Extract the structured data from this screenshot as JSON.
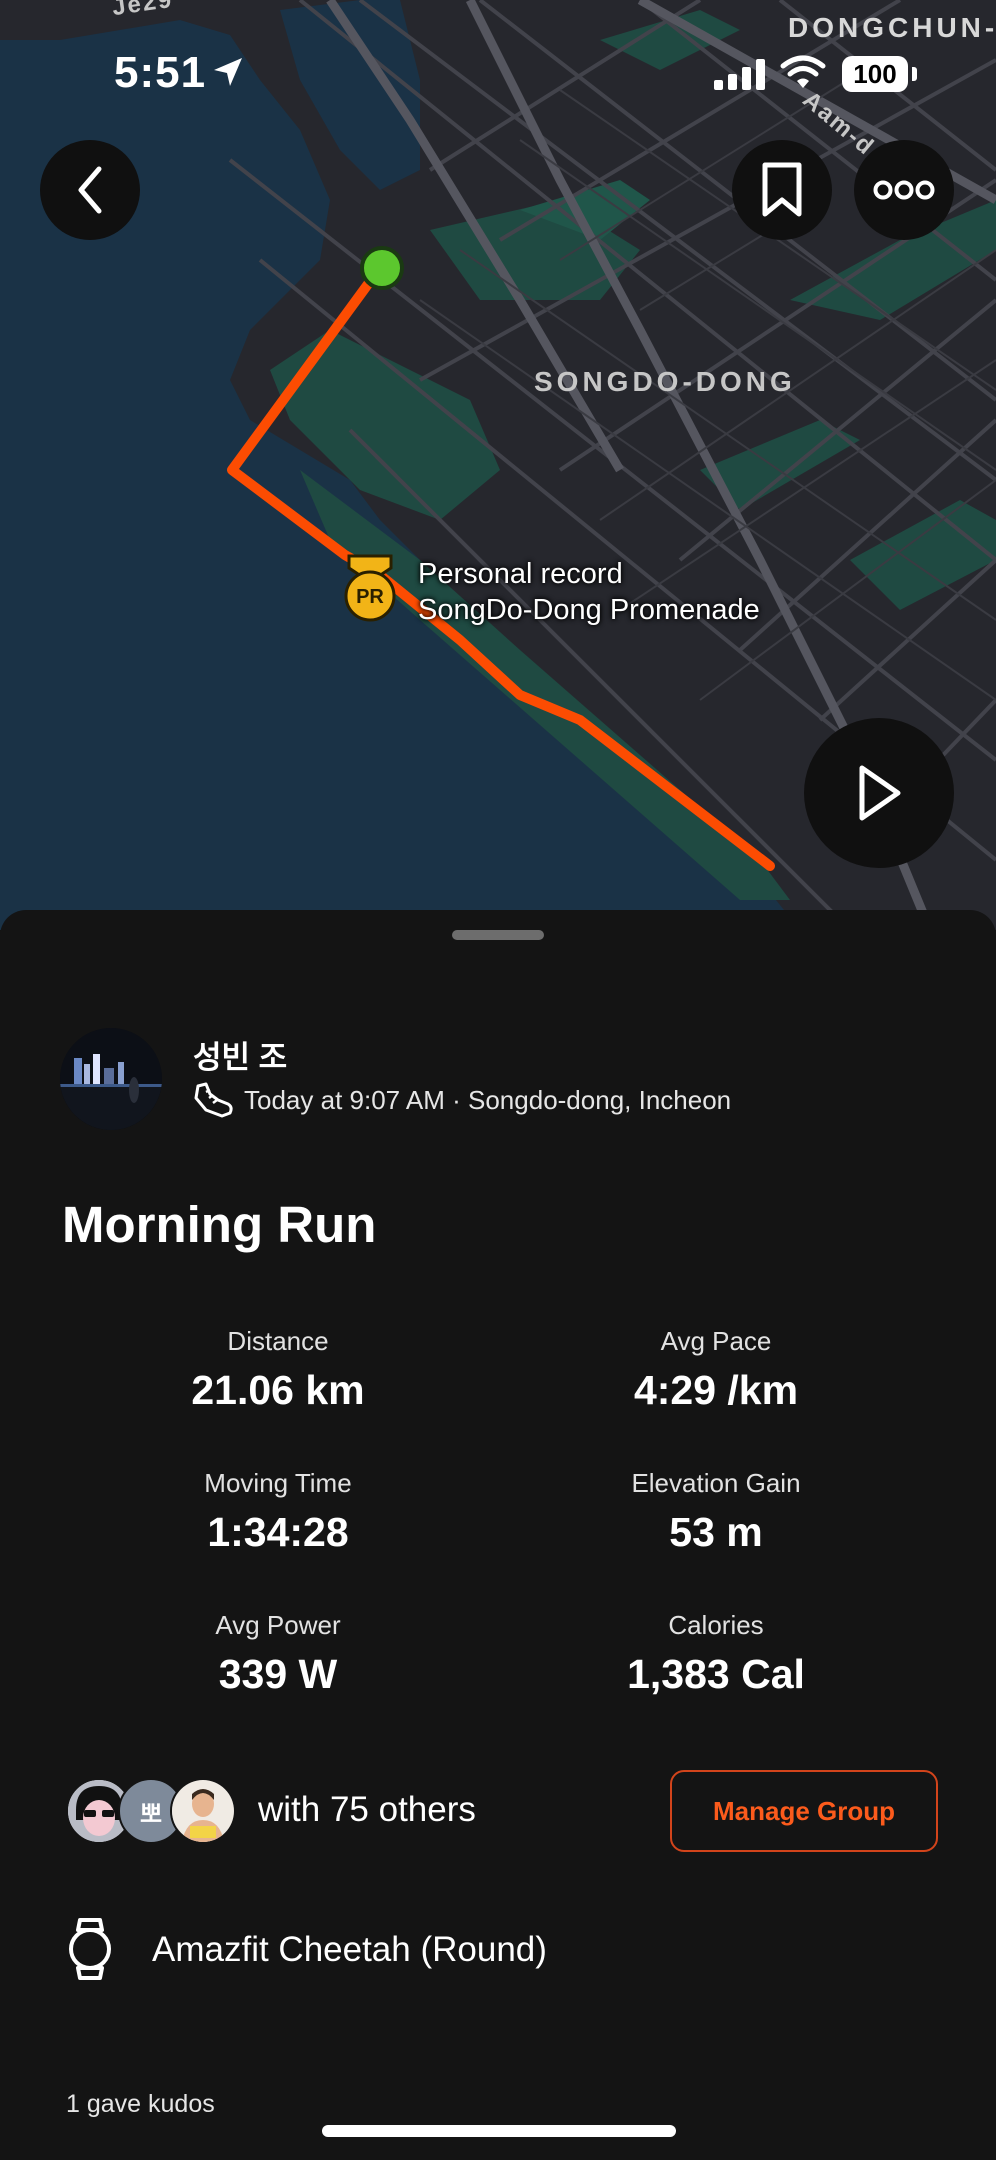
{
  "status_bar": {
    "time": "5:51",
    "battery": "100"
  },
  "map": {
    "labels": {
      "district": "SONGDO-DONG",
      "corner_district": "DONGCHUN-",
      "road": "Aam-d",
      "corner_road": "Je29"
    },
    "pr_badge": "PR",
    "pr_title": "Personal record",
    "pr_segment": "SongDo-Dong Promenade",
    "route_color": "#fc4c02",
    "start_color": "#5cc72e"
  },
  "activity": {
    "athlete_name": "성빈 조",
    "meta": "Today at 9:07 AM · Songdo-dong, Incheon",
    "title": "Morning Run",
    "stats": [
      {
        "label": "Distance",
        "value": "21.06 km"
      },
      {
        "label": "Avg Pace",
        "value": "4:29 /km"
      },
      {
        "label": "Moving Time",
        "value": "1:34:28"
      },
      {
        "label": "Elevation Gain",
        "value": "53 m"
      },
      {
        "label": "Avg Power",
        "value": "339 W"
      },
      {
        "label": "Calories",
        "value": "1,383 Cal"
      }
    ],
    "group_avatar_text": "뽀",
    "group_text": "with 75 others",
    "manage_group_label": "Manage Group",
    "device": "Amazfit Cheetah (Round)",
    "kudos": "1 gave kudos"
  },
  "colors": {
    "accent": "#fc5b1c",
    "sheet_bg": "#141414",
    "water": "#1a3246",
    "park": "#1f4a42"
  }
}
